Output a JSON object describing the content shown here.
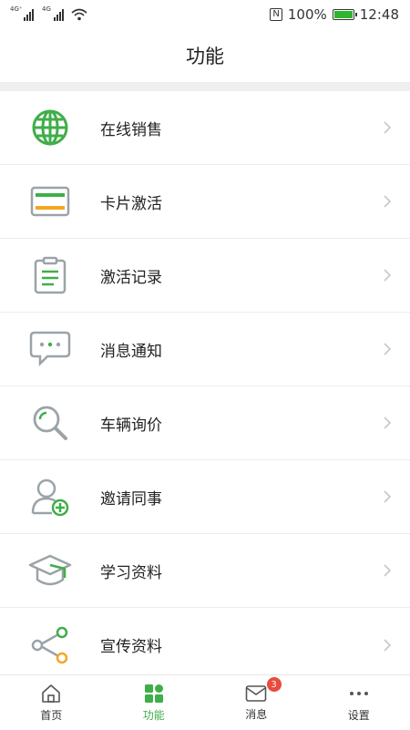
{
  "status_bar": {
    "network_left_1": "4G⁺",
    "network_left_2": "4G",
    "nfc": "N",
    "battery_percent": "100%",
    "time": "12:48"
  },
  "header": {
    "title": "功能"
  },
  "menu": {
    "items": [
      {
        "label": "在线销售",
        "icon": "globe-icon"
      },
      {
        "label": "卡片激活",
        "icon": "card-icon"
      },
      {
        "label": "激活记录",
        "icon": "clipboard-icon"
      },
      {
        "label": "消息通知",
        "icon": "chat-bubble-icon"
      },
      {
        "label": "车辆询价",
        "icon": "search-icon"
      },
      {
        "label": "邀请同事",
        "icon": "add-user-icon"
      },
      {
        "label": "学习资料",
        "icon": "graduation-cap-icon"
      },
      {
        "label": "宣传资料",
        "icon": "share-icon"
      }
    ]
  },
  "tabbar": {
    "tabs": [
      {
        "label": "首页",
        "icon": "home-icon"
      },
      {
        "label": "功能",
        "icon": "grid-icon",
        "active": true
      },
      {
        "label": "消息",
        "icon": "mail-icon",
        "badge": "3"
      },
      {
        "label": "设置",
        "icon": "more-icon"
      }
    ]
  },
  "colors": {
    "accent": "#3fae49",
    "orange": "#f5a623",
    "badge": "#e94b3c",
    "gray_icon": "#9aa3a8"
  }
}
